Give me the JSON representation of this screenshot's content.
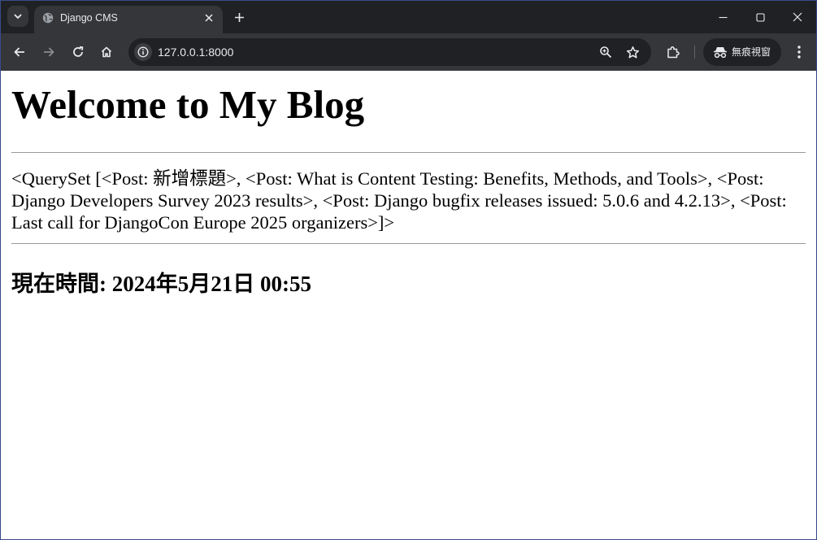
{
  "browser": {
    "tab_title": "Django CMS",
    "url": "127.0.0.1:8000",
    "incognito_label": "無痕視窗",
    "colors": {
      "frame": "#202124",
      "toolbar": "#35363a",
      "text": "#e8eaed"
    }
  },
  "page": {
    "heading": "Welcome to My Blog",
    "queryset": "<QuerySet [<Post: 新增標題>, <Post: What is Content Testing: Benefits, Methods, and Tools>, <Post: Django Developers Survey 2023 results>, <Post: Django bugfix releases issued: 5.0.6 and 4.2.13>, <Post: Last call for DjangoCon Europe 2025 organizers>]>",
    "current_time": "現在時間: 2024年5月21日 00:55"
  },
  "icons": [
    "tab-search-icon",
    "globe-favicon-icon",
    "close-icon",
    "plus-icon",
    "minimize-icon",
    "maximize-icon",
    "window-close-icon",
    "back-arrow-icon",
    "forward-arrow-icon",
    "reload-icon",
    "home-icon",
    "info-icon",
    "zoom-icon",
    "star-icon",
    "extensions-icon",
    "incognito-icon",
    "menu-dots-icon"
  ]
}
